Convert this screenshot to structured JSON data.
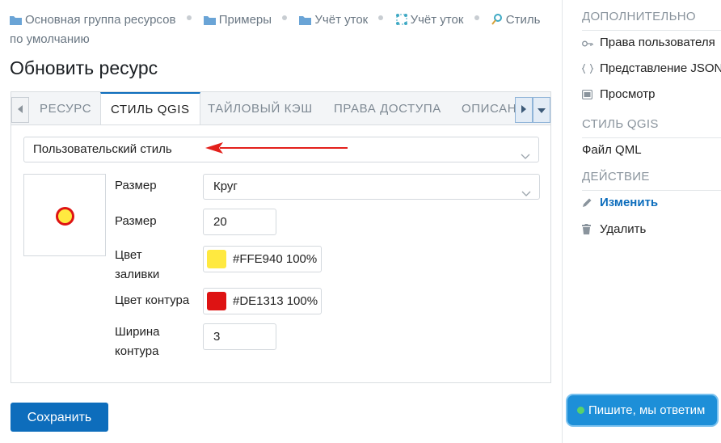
{
  "breadcrumb": {
    "items": [
      {
        "label": "Основная группа ресурсов",
        "icon": "folder-icon"
      },
      {
        "label": "Примеры",
        "icon": "folder-icon"
      },
      {
        "label": "Учёт уток",
        "icon": "folder-icon"
      },
      {
        "label": "Учёт уток",
        "icon": "vector-layer-icon"
      },
      {
        "label": "Стиль по умолчанию",
        "icon": "style-icon"
      }
    ]
  },
  "page": {
    "title": "Обновить ресурс"
  },
  "tabs": [
    {
      "label": "Ресурс",
      "active": false
    },
    {
      "label": "Стиль QGIS",
      "active": true
    },
    {
      "label": "Тайловый кэш",
      "active": false
    },
    {
      "label": "Права доступа",
      "active": false
    },
    {
      "label": "Описан",
      "active": false
    }
  ],
  "style_form": {
    "style_type": "Пользовательский стиль",
    "size_shape_label": "Размер",
    "shape_value": "Круг",
    "size_label": "Размер",
    "size_value": "20",
    "fill_label": "Цвет заливки",
    "fill_color_text": "#FFE940 100%",
    "fill_color": "#FFE940",
    "stroke_label": "Цвет контура",
    "stroke_color_text": "#DE1313 100%",
    "stroke_color": "#DE1313",
    "stroke_width_label": "Ширина контура",
    "stroke_width_value": "3"
  },
  "save_button": "Сохранить",
  "sidebar": {
    "sections": [
      {
        "header": "Дополнительно",
        "items": [
          {
            "label": "Права пользователя",
            "icon": "key-icon"
          },
          {
            "label": "Представление JSON",
            "icon": "braces-icon"
          },
          {
            "label": "Просмотр",
            "icon": "preview-icon"
          }
        ]
      },
      {
        "header": "Стиль QGIS",
        "items": [
          {
            "label": "Файл QML"
          }
        ]
      },
      {
        "header": "Действие",
        "items": [
          {
            "label": "Изменить",
            "icon": "pencil-icon",
            "active": true
          },
          {
            "label": "Удалить",
            "icon": "trash-icon"
          }
        ]
      }
    ]
  },
  "chat": {
    "label": "Пишите, мы ответим"
  },
  "colors": {
    "accent": "#0d6dbc",
    "annotation_arrow": "#e3201b"
  }
}
